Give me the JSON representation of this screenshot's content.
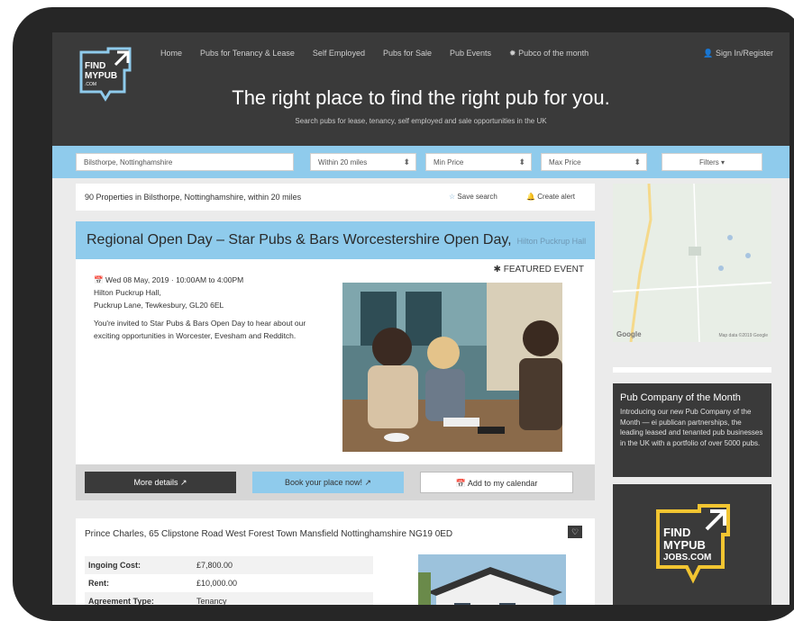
{
  "nav": {
    "items": [
      "Home",
      "Pubs for Tenancy & Lease",
      "Self Employed",
      "Pubs for Sale",
      "Pub Events",
      "Pubco of the month"
    ],
    "signin": "Sign In/Register"
  },
  "logo": {
    "line1": "FIND",
    "line2": "MYPUB",
    "line3": ".COM"
  },
  "hero": {
    "tagline": "The right place to find the right pub for you.",
    "subtag": "Search pubs for lease, tenancy, self employed and sale opportunities in the UK"
  },
  "search": {
    "location": "Bilsthorpe, Nottinghamshire",
    "radius": "Within 20 miles",
    "min_price": "Min Price",
    "max_price": "Max Price",
    "filters": "Filters"
  },
  "results": {
    "count": "90 Properties in Bilsthorpe, Nottinghamshire, within 20 miles",
    "save": "Save search",
    "alert": "Create alert"
  },
  "event": {
    "title": "Regional Open Day – Star Pubs & Bars Worcestershire Open Day,",
    "venue": "Hilton Puckrup Hall",
    "featured": "FEATURED EVENT",
    "datetime": "Wed 08 May, 2019 · 10:00AM to 4:00PM",
    "address1": "Hilton Puckrup Hall,",
    "address2": "Puckrup Lane, Tewkesbury, GL20 6EL",
    "description": "You're invited to Star Pubs & Bars Open Day to hear about our exciting opportunities in Worcester, Evesham and Redditch.",
    "btn_details": "More details",
    "btn_book": "Book your place now!",
    "btn_calendar": "Add to my calendar"
  },
  "listing": {
    "title": "Prince Charles, 65 Clipstone Road West Forest Town Mansfield Nottinghamshire NG19 0ED",
    "rows": [
      {
        "label": "Ingoing Cost:",
        "value": "£7,800.00"
      },
      {
        "label": "Rent:",
        "value": "£10,000.00"
      },
      {
        "label": "Agreement Type:",
        "value": "Tenancy"
      }
    ]
  },
  "map": {
    "attribution": "Map data ©2019 Google",
    "provider": "Google"
  },
  "pubco": {
    "title": "Pub Company of the Month",
    "text": "Introducing our new Pub Company of the Month — ei publican partnerships, the leading leased and tenanted pub businesses in the UK with a portfolio of over 5000 pubs."
  },
  "jobs": {
    "line1": "FIND",
    "line2": "MYPUB",
    "line3": "JOBS.COM"
  },
  "colors": {
    "accent_blue": "#8fcbec",
    "dark": "#3a3a3a",
    "brand_yellow": "#f2c531"
  }
}
